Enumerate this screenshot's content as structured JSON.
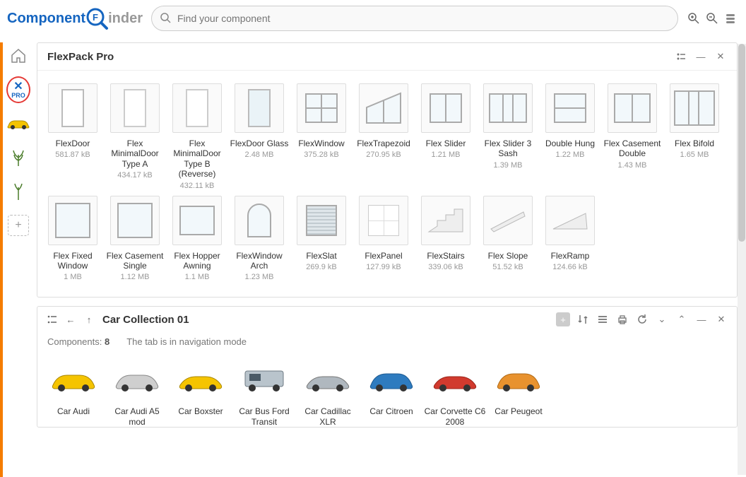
{
  "header": {
    "logo_part1": "Component",
    "logo_part2": "inder",
    "search_placeholder": "Find your component"
  },
  "sidebar": {
    "pro_x": "✕",
    "pro_label": "PRO"
  },
  "panel1": {
    "title": "FlexPack Pro",
    "items": [
      {
        "name": "FlexDoor",
        "size": "581.87 kB"
      },
      {
        "name": "Flex MinimalDoor Type A",
        "size": "434.17 kB"
      },
      {
        "name": "Flex MinimalDoor Type B (Reverse)",
        "size": "432.11 kB"
      },
      {
        "name": "FlexDoor Glass",
        "size": "2.48 MB"
      },
      {
        "name": "FlexWindow",
        "size": "375.28 kB"
      },
      {
        "name": "FlexTrapezoid",
        "size": "270.95 kB"
      },
      {
        "name": "Flex Slider",
        "size": "1.21 MB"
      },
      {
        "name": "Flex Slider 3 Sash",
        "size": "1.39 MB"
      },
      {
        "name": "Double Hung",
        "size": "1.22 MB"
      },
      {
        "name": "Flex Casement Double",
        "size": "1.43 MB"
      },
      {
        "name": "Flex Bifold",
        "size": "1.65 MB"
      },
      {
        "name": "Flex Fixed Window",
        "size": "1 MB"
      },
      {
        "name": "Flex Casement Single",
        "size": "1.12 MB"
      },
      {
        "name": "Flex Hopper Awning",
        "size": "1.1 MB"
      },
      {
        "name": "FlexWindow Arch",
        "size": "1.23 MB"
      },
      {
        "name": "FlexSlat",
        "size": "269.9 kB"
      },
      {
        "name": "FlexPanel",
        "size": "127.99 kB"
      },
      {
        "name": "FlexStairs",
        "size": "339.06 kB"
      },
      {
        "name": "Flex Slope",
        "size": "51.52 kB"
      },
      {
        "name": "FlexRamp",
        "size": "124.66 kB"
      }
    ]
  },
  "panel2": {
    "title": "Car Collection 01",
    "components_label": "Components:",
    "components_count": "8",
    "mode_text": "The tab is in navigation mode",
    "items": [
      {
        "name": "Car Audi"
      },
      {
        "name": "Car Audi A5 mod"
      },
      {
        "name": "Car Boxster"
      },
      {
        "name": "Car Bus Ford Transit"
      },
      {
        "name": "Car Cadillac XLR"
      },
      {
        "name": "Car Citroen"
      },
      {
        "name": "Car Corvette C6 2008"
      },
      {
        "name": "Car Peugeot"
      }
    ]
  }
}
